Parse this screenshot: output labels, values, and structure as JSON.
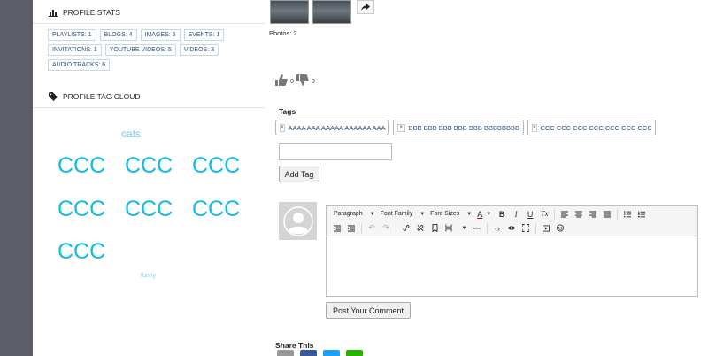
{
  "profile_stats": {
    "title": "PROFILE STATS",
    "items": [
      "PLAYLISTS: 1",
      "BLOGS: 4",
      "IMAGES: 6",
      "EVENTS: 1",
      "INVITATIONS: 1",
      "YOUTUBE VIDEOS: 5",
      "VIDEOS: 3",
      "AUDIO TRACKS: 6"
    ]
  },
  "tag_cloud": {
    "title": "PROFILE TAG CLOUD",
    "small_top": "cats",
    "large": [
      "CCC",
      "CCC",
      "CCC",
      "CCC",
      "CCC",
      "CCC",
      "CCC"
    ],
    "small_bottom": "funny"
  },
  "photos": {
    "count_label": "Photos: 2"
  },
  "votes": {
    "up_count": "0",
    "down_count": "0"
  },
  "tags": {
    "label": "Tags",
    "items": [
      "AAAA AAA AAAAA AAAAAA AAA",
      "BBB BBB BBB BBB BBB BBBBBBBB",
      "CCC CCC CCC CCC CCC CCC CCC"
    ],
    "remove_glyph": "×",
    "add_button": "Add Tag"
  },
  "editor": {
    "paragraph": "Paragraph",
    "font_family": "Font Family",
    "font_sizes": "Font Sizes",
    "color_letter": "A",
    "bold": "B",
    "italic": "I",
    "underline": "U",
    "clear": "Tx"
  },
  "comment": {
    "post_button": "Post Your Comment"
  },
  "share": {
    "label": "Share This"
  },
  "colors": {
    "tag_cloud_large": "#12bce6",
    "tag_cloud_small": "#7ec8e8",
    "link_blue": "#2b4f7a"
  }
}
